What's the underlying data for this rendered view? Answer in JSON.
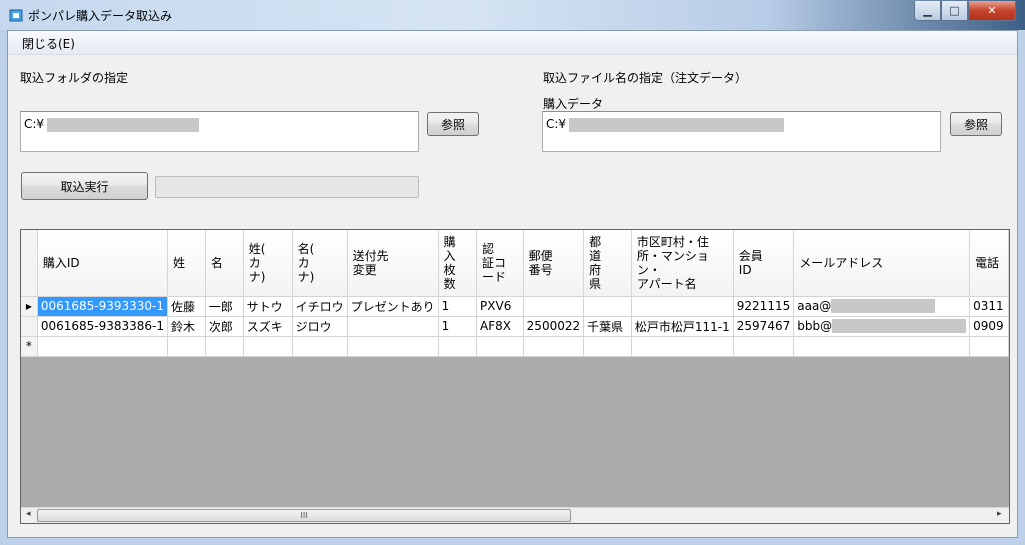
{
  "window": {
    "title": "ポンパレ購入データ取込み"
  },
  "menu": {
    "close_label": "閉じる(E)"
  },
  "folder": {
    "label": "取込フォルダの指定",
    "path_prefix": "C:¥",
    "browse_label": "参照"
  },
  "file": {
    "label": "取込ファイル名の指定（注文データ）",
    "sub_label": "購入データ",
    "path_prefix": "C:¥",
    "browse_label": "参照"
  },
  "import_button": {
    "label": "取込実行"
  },
  "grid": {
    "columns": [
      "購入ID",
      "姓",
      "名",
      "姓(\nカ\nナ)",
      "名(\nカ\nナ)",
      "送付先\n変更",
      "購\n入\n枚\n数",
      "認\n証コ\nード",
      "郵便\n番号",
      "都\n道\n府\n県",
      "市区町村・住\n所・マンション・\nアパート名",
      "会員\nID",
      "メールアドレス",
      "電話"
    ],
    "rows": [
      [
        "0061685-9393330-1",
        "佐藤",
        "一郎",
        "サトウ",
        "イチロウ",
        "プレゼントあり",
        "1",
        "PXV6",
        "",
        "",
        "",
        "9221115",
        "aaa@",
        "0311"
      ],
      [
        "0061685-9383386-1",
        "鈴木",
        "次郎",
        "スズキ",
        "ジロウ",
        "",
        "1",
        "AF8X",
        "2500022",
        "千葉県",
        "松戸市松戸111-1",
        "2597467",
        "bbb@",
        "0909"
      ]
    ],
    "new_row_marker": "*",
    "current_row_marker": "▸"
  },
  "scrollbar": {
    "grip": "III",
    "left_arrow": "◂",
    "right_arrow": "▸"
  }
}
